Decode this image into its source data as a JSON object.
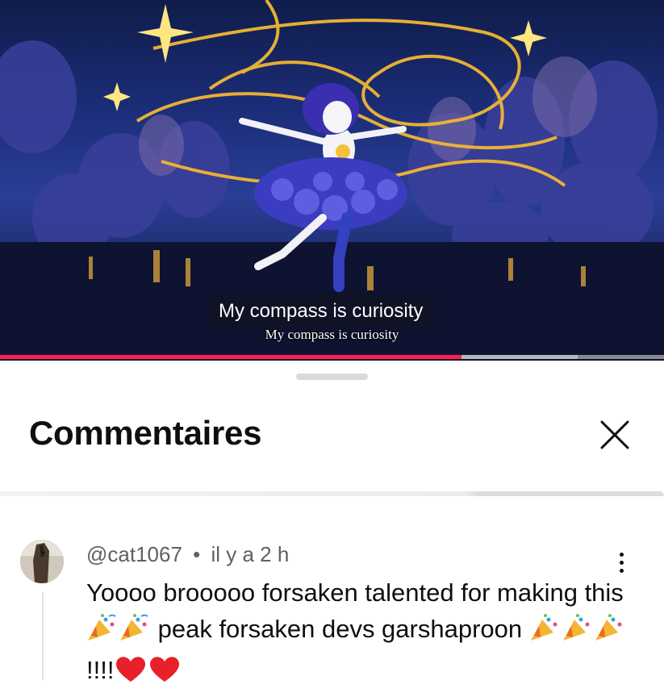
{
  "video": {
    "subtitle_main": "My compass is curiosity",
    "subtitle_burned": "My compass is curiosity",
    "progress": {
      "played_fraction": 0.695,
      "buffered_fraction": 0.87,
      "played_color": "#ff1f4f"
    }
  },
  "comments_panel": {
    "title": "Commentaires",
    "close_icon": "close-icon"
  },
  "comment": {
    "author": "@cat1067",
    "separator": "•",
    "time": "il y a 2 h",
    "text_part1": "Yoooo brooooo forsaken talented for making this ",
    "text_part2": " peak forsaken devs garshaproon ",
    "text_part3": "!!!!",
    "emoji_party": "party-popper-icon",
    "emoji_heart": "red-heart-icon",
    "menu_icon": "more-vertical-icon"
  }
}
